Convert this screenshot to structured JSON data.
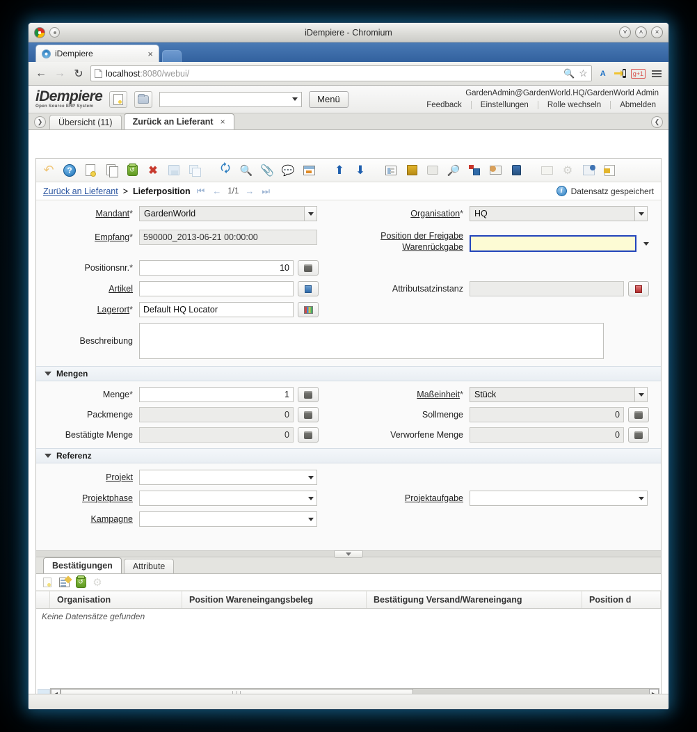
{
  "window": {
    "title": "iDempiere - Chromium",
    "browser_tab": "iDempiere",
    "tab_close": "×",
    "url_host": "localhost",
    "url_rest": ":8080/webui/",
    "minimize": "˅",
    "maximize": "˄",
    "close": "×"
  },
  "app_header": {
    "logo_main": "iDempiere",
    "logo_sub": "Open Source    ERP System",
    "search_value": "",
    "menu_label": "Menü",
    "user_line": "GardenAdmin@GardenWorld.HQ/GardenWorld Admin",
    "links": [
      {
        "label": "Feedback"
      },
      {
        "label": "Einstellungen"
      },
      {
        "label": "Rolle wechseln"
      },
      {
        "label": "Abmelden"
      }
    ]
  },
  "window_tabs": [
    {
      "label": "Übersicht (11)",
      "active": false,
      "closable": false
    },
    {
      "label": "Zurück an Lieferant",
      "active": true,
      "closable": true,
      "close": "×"
    }
  ],
  "side_handles": {
    "left": "❯",
    "right": "❮"
  },
  "toolbar": {
    "icons": [
      {
        "name": "undo-icon",
        "title": "Undo"
      },
      {
        "name": "help-icon",
        "title": "Hilfe"
      },
      {
        "name": "new-record-icon",
        "title": "Neuer Datensatz"
      },
      {
        "name": "copy-record-icon",
        "title": "Datensatz kopieren"
      },
      {
        "name": "delete-record-icon",
        "title": "Löschen"
      },
      {
        "name": "delete-selection-icon",
        "title": "Auswahl löschen"
      },
      {
        "name": "save-icon",
        "title": "Speichern"
      },
      {
        "name": "save-as-new-icon",
        "title": "Als neu speichern"
      },
      {
        "name": "refresh-icon",
        "title": "Aktualisieren"
      },
      {
        "name": "find-icon",
        "title": "Suchen"
      },
      {
        "name": "attachment-icon",
        "title": "Anhang"
      },
      {
        "name": "chat-icon",
        "title": "Notiz"
      },
      {
        "name": "report-icon",
        "title": "Bericht"
      },
      {
        "name": "parent-record-icon",
        "title": "Übergeordnet"
      },
      {
        "name": "detail-record-icon",
        "title": "Detail"
      },
      {
        "name": "form-view-icon",
        "title": "Formularansicht"
      },
      {
        "name": "archive-icon",
        "title": "Archiv"
      },
      {
        "name": "print-icon",
        "title": "Drucken"
      },
      {
        "name": "zoom-across-icon",
        "title": "Zoom"
      },
      {
        "name": "process-icon",
        "title": "Prozess"
      },
      {
        "name": "email-icon",
        "title": "E-Mail"
      },
      {
        "name": "export-icon",
        "title": "Export"
      },
      {
        "name": "grid-toggle-icon",
        "title": "Gitter"
      },
      {
        "name": "preference-icon",
        "title": "Einstellungen"
      },
      {
        "name": "archive-document-icon",
        "title": "Dokument archivieren"
      },
      {
        "name": "exit-icon",
        "title": "Beenden"
      }
    ]
  },
  "breadcrumb": {
    "parent": "Zurück an Lieferant",
    "separator": ">",
    "current": "Lieferposition",
    "first": "⏮",
    "prev": "←",
    "position": "1/1",
    "next": "→",
    "last": "⏭",
    "status_message": "Datensatz gespeichert",
    "status_icon": "i"
  },
  "form": {
    "fields": {
      "mandant": {
        "label": "Mandant",
        "required": "*",
        "value": "GardenWorld",
        "type": "select",
        "readonly": true
      },
      "organisation": {
        "label": "Organisation",
        "required": "*",
        "value": "HQ",
        "type": "select",
        "readonly": true
      },
      "empfang": {
        "label": "Empfang",
        "required": "*",
        "value": "590000_2013-06-21 00:00:00",
        "type": "text",
        "readonly": true
      },
      "freigabe": {
        "label_line1": "Position der Freigabe",
        "label_line2": "Warenrückgabe",
        "value": "",
        "type": "select",
        "focused": true
      },
      "positionsnr": {
        "label": "Positionsnr.",
        "required": "*",
        "value": "10",
        "type": "number"
      },
      "artikel": {
        "label": "Artikel",
        "value": "",
        "type": "lookup"
      },
      "attributsatzinstanz": {
        "label": "Attributsatzinstanz",
        "value": "",
        "type": "lookup",
        "readonly": true
      },
      "lagerort": {
        "label": "Lagerort",
        "required": "*",
        "value": "Default HQ Locator",
        "type": "lookup"
      },
      "beschreibung": {
        "label": "Beschreibung",
        "value": "",
        "type": "textarea"
      }
    },
    "groups": {
      "mengen": {
        "title": "Mengen",
        "fields": {
          "menge": {
            "label": "Menge",
            "required": "*",
            "value": "1"
          },
          "masseinheit": {
            "label": "Maßeinheit",
            "required": "*",
            "value": "Stück"
          },
          "packmenge": {
            "label": "Packmenge",
            "value": "0",
            "readonly": true
          },
          "sollmenge": {
            "label": "Sollmenge",
            "value": "0",
            "readonly": true
          },
          "bestaetigte_menge": {
            "label": "Bestätigte Menge",
            "value": "0",
            "readonly": true
          },
          "verworfene_menge": {
            "label": "Verworfene Menge",
            "value": "0",
            "readonly": true
          }
        }
      },
      "referenz": {
        "title": "Referenz",
        "fields": {
          "projekt": {
            "label": "Projekt",
            "value": ""
          },
          "projektphase": {
            "label": "Projektphase",
            "value": ""
          },
          "projektaufgabe": {
            "label": "Projektaufgabe",
            "value": ""
          },
          "kampagne": {
            "label": "Kampagne",
            "value": ""
          }
        }
      }
    }
  },
  "bottom": {
    "tabs": [
      {
        "label": "Bestätigungen",
        "active": true
      },
      {
        "label": "Attribute",
        "active": false
      }
    ],
    "grid_toolbar": [
      {
        "name": "new-row-icon"
      },
      {
        "name": "edit-row-icon"
      },
      {
        "name": "delete-row-icon"
      },
      {
        "name": "customize-icon"
      }
    ],
    "columns": [
      {
        "label": ""
      },
      {
        "label": "Organisation"
      },
      {
        "label": "Position Wareneingangsbeleg"
      },
      {
        "label": "Bestätigung Versand/Wareneingang"
      },
      {
        "label": "Position d"
      }
    ],
    "empty_text": "Keine Datensätze gefunden",
    "scroll_thumb_glyph": "∣∣∣",
    "scroll_left": "◀",
    "scroll_right": "▶"
  }
}
